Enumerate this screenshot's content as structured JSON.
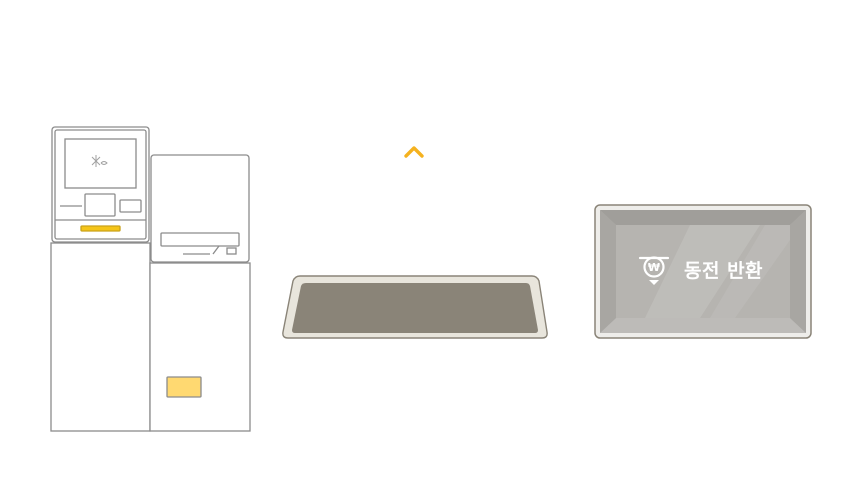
{
  "coin_return": {
    "label": "동전 반환",
    "icon": "won-coin-icon"
  },
  "indicator": {
    "icon": "chevron-up-icon",
    "color": "#f5b21f"
  },
  "colors": {
    "highlight": "#f5c518",
    "card_slot": "#ffd971",
    "tray_fill": "#8a8478",
    "outline": "#8c8c8c"
  }
}
